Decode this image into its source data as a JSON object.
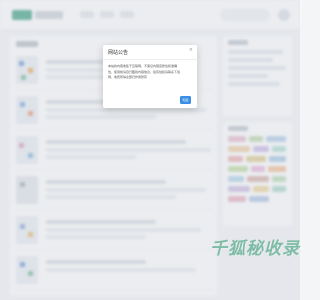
{
  "modal": {
    "title": "网站公告",
    "close_icon": "×",
    "body_lines": [
      "本站的内容收集于互联网，不保证内容完整性和准确",
      "性，使用前请自行甄别内容信息，如有侵权请联系下载",
      "网，收费所得全部归作者所有"
    ],
    "ok_label": "知道"
  },
  "watermark": {
    "text": "千狐秘收录"
  },
  "colors": {
    "accent": "#3a8ee6",
    "brand": "#2d9a7b",
    "watermark": "#3aa779"
  }
}
